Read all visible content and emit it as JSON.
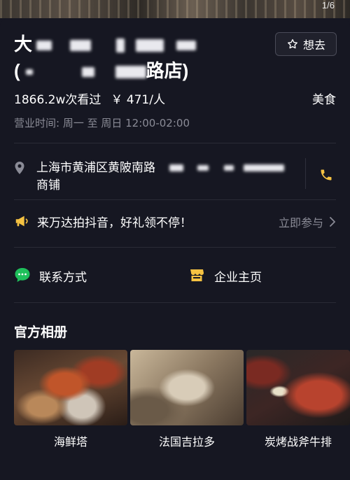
{
  "hero": {
    "page_indicator": "1/6"
  },
  "store": {
    "name_line1_visible": "大",
    "name_line2_prefix": "(",
    "name_line2_suffix": "路店)",
    "want_label": "想去",
    "views": "1866.2w次看过",
    "price": "￥ 471/人",
    "category": "美食",
    "hours": "营业时间: 周一 至 周日  12:00-02:00",
    "address_line1": "上海市黄浦区黄陂南路",
    "address_line2": "商铺"
  },
  "promo": {
    "text": "来万达拍抖音，好礼领不停！",
    "action": "立即参与"
  },
  "links": {
    "contact": "联系方式",
    "enterprise": "企业主页"
  },
  "album": {
    "title": "官方相册",
    "photos": [
      {
        "caption": "海鲜塔"
      },
      {
        "caption": "法国吉拉多"
      },
      {
        "caption": "炭烤战斧牛排"
      }
    ]
  },
  "colors": {
    "background": "#161722",
    "secondary_text": "#8a8b96",
    "accent_yellow": "#f5c242",
    "contact_green": "#1fbf5b"
  },
  "icons": {
    "want": "star-outline-icon",
    "address": "location-pin-icon",
    "phone": "phone-icon",
    "promo": "megaphone-icon",
    "contact": "chat-bubble-icon",
    "enterprise": "shop-icon",
    "chevron": "chevron-right-icon"
  }
}
